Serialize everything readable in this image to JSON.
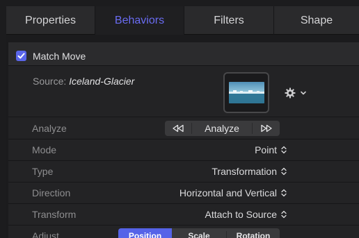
{
  "tabs": [
    {
      "label": "Properties",
      "active": false
    },
    {
      "label": "Behaviors",
      "active": true
    },
    {
      "label": "Filters",
      "active": false
    },
    {
      "label": "Shape",
      "active": false
    }
  ],
  "accent_color": "#5a66ea",
  "behavior": {
    "enabled": true,
    "name": "Match Move",
    "source_label": "Source:",
    "source_value": "Iceland-Glacier"
  },
  "analyze": {
    "label": "Analyze",
    "rewind_icon": "rewind-icon",
    "button_label": "Analyze",
    "forward_icon": "fast-forward-icon"
  },
  "params": [
    {
      "label": "Mode",
      "value": "Point"
    },
    {
      "label": "Type",
      "value": "Transformation"
    },
    {
      "label": "Direction",
      "value": "Horizontal and Vertical"
    },
    {
      "label": "Transform",
      "value": "Attach to Source"
    }
  ],
  "adjust": {
    "label": "Adjust",
    "options": [
      "Position",
      "Scale",
      "Rotation"
    ],
    "selected": "Position"
  }
}
